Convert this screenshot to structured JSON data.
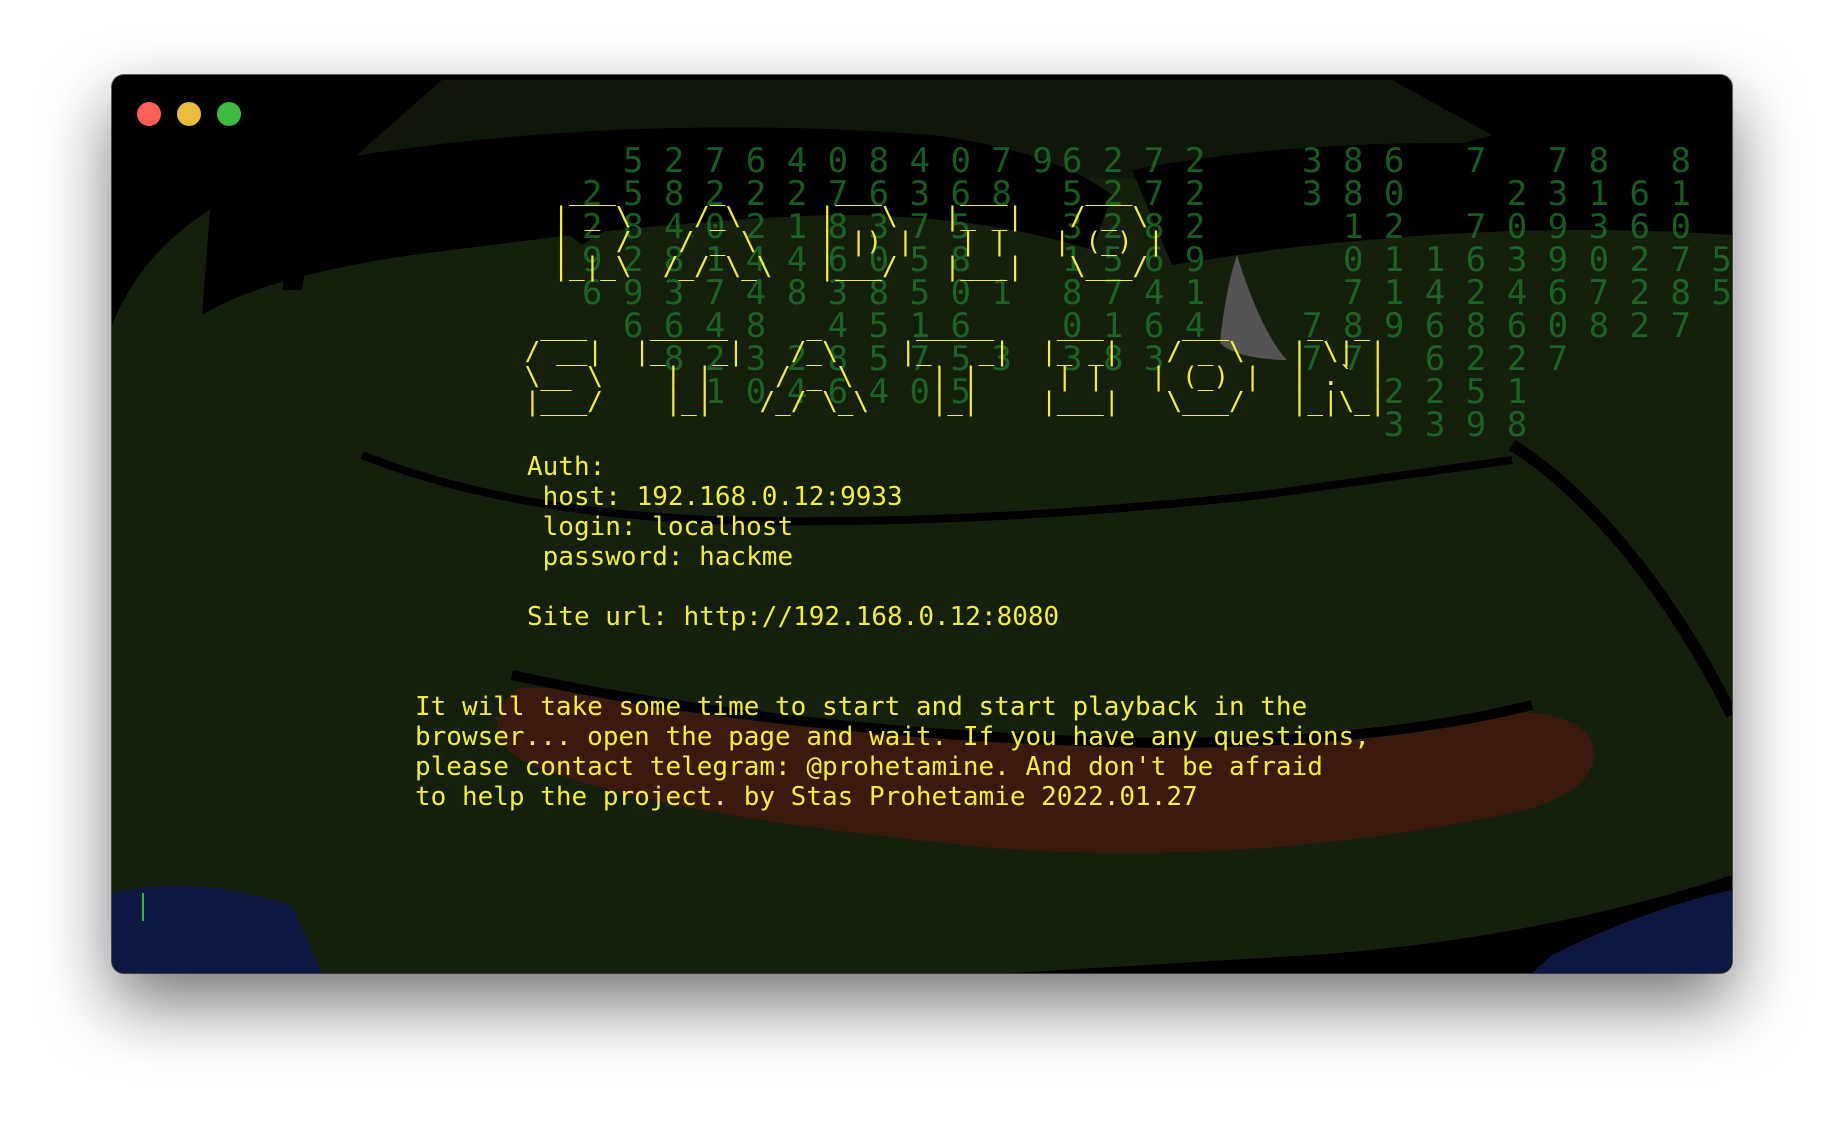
{
  "window": {
    "traffic_lights": [
      {
        "name": "close",
        "color": "#ff5f57"
      },
      {
        "name": "minimize",
        "color": "#e9bc3c"
      },
      {
        "name": "zoom",
        "color": "#3fb93f"
      }
    ]
  },
  "colors": {
    "terminal_text": "#f2ee3a",
    "background": "#000000",
    "pepe_green": "#141f0c",
    "matrix_green": "#1f7a2e",
    "cursor": "#2fb34a"
  },
  "banner": {
    "line1": "   ___      _       ___     ___     ___  \n  | _ \\    /_\\     |   \\   |_ _|   / _ \\ \n  |   /   / _ \\    | |) |   | |   | (_) |\n  |_|_\\  /_/ \\_\\   |___/   |___|   \\___/ ",
    "line2": "  ___    _____     _      _____    ___     ___     _  _ \n / __|  |_   _|   /_\\    |_   _|  |_ _|   / _ \\   | \\| |\n \\__ \\    | |    / _ \\     | |     | |   | (_) |  | .` |\n |___/    |_|   /_/ \\_\\    |_|    |___|   \\___/   |_|\\_|"
  },
  "auth": {
    "heading": "Auth:",
    "host": " host: 192.168.0.12:9933",
    "login": " login: localhost",
    "password": " password: hackme"
  },
  "site": {
    "url_line": "Site url: http://192.168.0.12:8080"
  },
  "message": {
    "line1": "It will take some time to start and start playback in the",
    "line2": "browser... open the page and wait. If you have any questions,",
    "line3": "please contact telegram: @prohetamine. And don't be afraid",
    "line4": "to help the project. by Stas Prohetamie 2022.01.27"
  }
}
